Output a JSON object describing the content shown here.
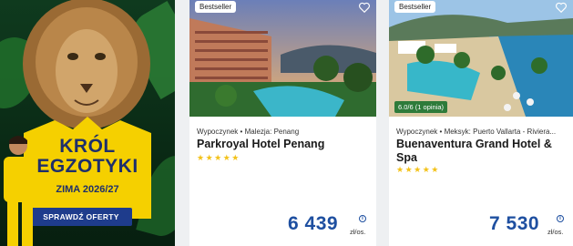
{
  "promo": {
    "title_line1": "KRÓL",
    "title_line2": "EGZOTYKI",
    "subtitle": "ZIMA 2026/27",
    "button_label": "SPRAWDŹ OFERTY",
    "accent_color": "#f5d000",
    "button_color": "#1e3c8c"
  },
  "offers": [
    {
      "badge": "Bestseller",
      "type": "Wypoczynek",
      "location": "Malezja: Penang",
      "hotel": "Parkroyal Hotel Penang",
      "stars": "★★★★★",
      "price": "6 439",
      "unit": "zł/os.",
      "info": "i"
    },
    {
      "badge": "Bestseller",
      "rating": "6.0/6 (1 opinia)",
      "type": "Wypoczynek",
      "location": "Meksyk: Puerto Vallarta - Riviera...",
      "hotel_line1": "Buenaventura Grand Hotel &",
      "hotel_line2": "Spa",
      "stars": "★★★★★",
      "price": "7 530",
      "unit": "zł/os.",
      "info": "i"
    }
  ],
  "icons": {
    "favorite": "heart-outline-icon",
    "info": "info-icon",
    "separator": "•"
  }
}
